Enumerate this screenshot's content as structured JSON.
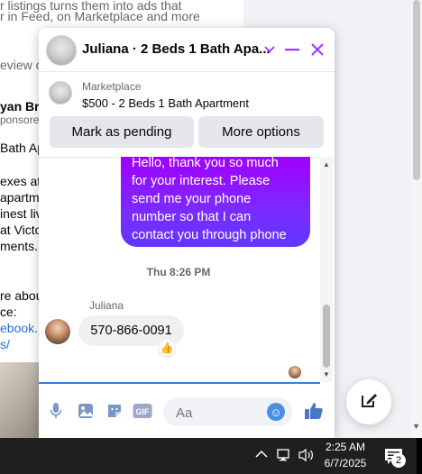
{
  "background": {
    "lines": [
      "r listings turns them into ads that",
      "r in Feed, on Marketplace and more",
      "eview c",
      "yan Bro",
      "ponsored",
      "Bath Ap",
      "exes at",
      "apartm",
      "inest liv",
      "at Victo",
      "ments. A",
      "re about",
      "ce:",
      "ebook.",
      "s/"
    ]
  },
  "chat": {
    "title": "Juliana · 2 Beds 1 Bath Apa...",
    "listing_source": "Marketplace",
    "listing_name": "$500 - 2 Beds 1 Bath Apartment",
    "mark_pending": "Mark as pending",
    "more_options": "More options",
    "outgoing_message": "Hello, thank you so much\nfor your interest. Please\nsend me your phone\nnumber so that I can\ncontact you through phone",
    "timestamp": "Thu 8:26 PM",
    "sender_name": "Juliana",
    "incoming_message": "570-866-0091",
    "reaction_icon": "thumbs-up",
    "composer_placeholder": "Aa",
    "accent_color": "#a033ff"
  },
  "taskbar": {
    "time": "2:25 AM",
    "date": "6/7/2025",
    "notification_count": "2"
  }
}
